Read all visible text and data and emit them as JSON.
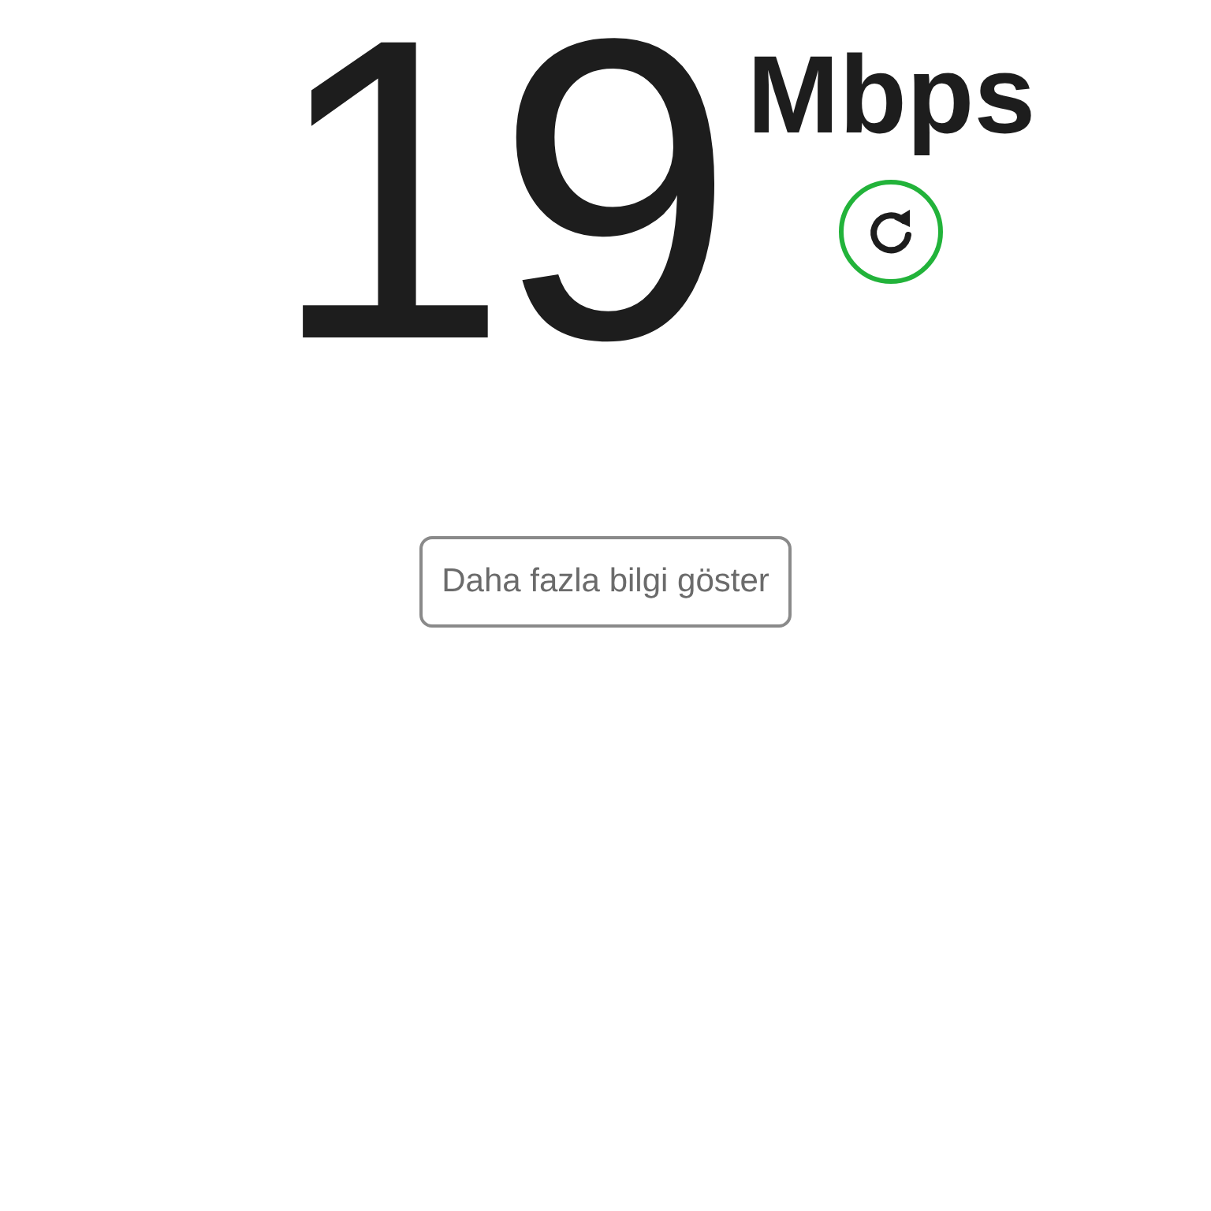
{
  "speed": {
    "value": "19",
    "unit": "Mbps"
  },
  "more_info_button": {
    "label": "Daha fazla bilgi göster"
  }
}
